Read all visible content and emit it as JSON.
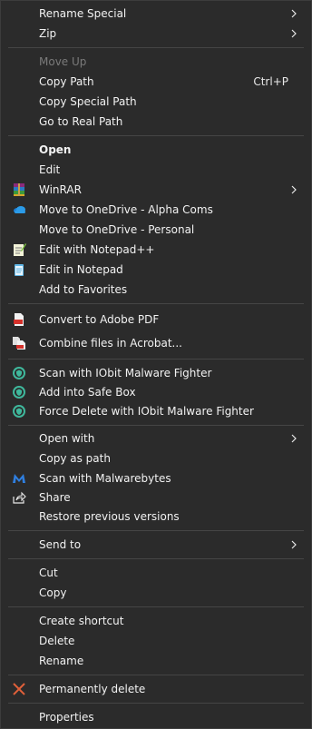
{
  "menu": {
    "rename_special": "Rename Special",
    "zip": "Zip",
    "move_up": "Move Up",
    "copy_path": "Copy Path",
    "copy_path_shortcut": "Ctrl+P",
    "copy_special_path": "Copy Special Path",
    "go_to_real_path": "Go to Real Path",
    "open": "Open",
    "edit": "Edit",
    "winrar": "WinRAR",
    "move_onedrive_alpha": "Move to OneDrive - Alpha Coms",
    "move_onedrive_personal": "Move to OneDrive - Personal",
    "edit_notepadpp": "Edit with Notepad++",
    "edit_in_notepad": "Edit in Notepad",
    "add_to_favorites": "Add to Favorites",
    "convert_adobe_pdf": "Convert to Adobe PDF",
    "combine_acrobat": "Combine files in Acrobat...",
    "scan_iobit": "Scan with IObit Malware Fighter",
    "add_safe_box": "Add into Safe Box",
    "force_delete_iobit": "Force Delete with IObit Malware Fighter",
    "open_with": "Open with",
    "copy_as_path": "Copy as path",
    "scan_malwarebytes": "Scan with Malwarebytes",
    "share": "Share",
    "restore_previous": "Restore previous versions",
    "send_to": "Send to",
    "cut": "Cut",
    "copy": "Copy",
    "create_shortcut": "Create shortcut",
    "delete": "Delete",
    "rename": "Rename",
    "permanently_delete": "Permanently delete",
    "properties": "Properties"
  },
  "colors": {
    "background": "#2b2b2b",
    "text": "#f2f2f2",
    "disabled_text": "#7a7a7a",
    "separator": "#454545",
    "delete_icon": "#e0603a",
    "iobit_green": "#3fb89c",
    "onedrive_blue": "#2b9be8",
    "acrobat_red": "#d5312b"
  }
}
